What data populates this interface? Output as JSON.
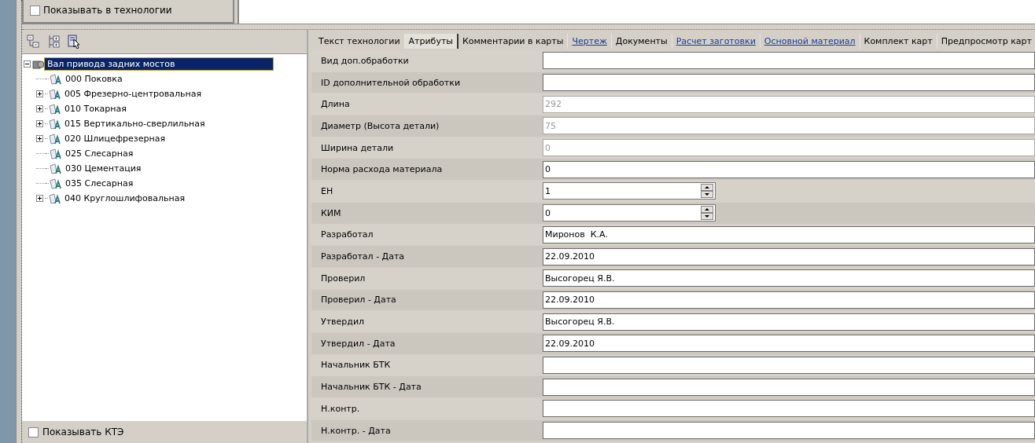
{
  "top_group": {
    "checkbox": {
      "label": "Показывать в технологии",
      "checked": false
    }
  },
  "tree_toolbar": {
    "buttons": [
      {
        "kind": "collapse"
      },
      {
        "kind": "expand"
      },
      {
        "kind": "select"
      }
    ]
  },
  "tree": {
    "root": {
      "label": "Вал привода задних мостов",
      "selected": true,
      "expanded": true,
      "children": [
        {
          "label": "000 Поковка",
          "selected": false
        },
        {
          "label": "005 Фрезерно-центровальная",
          "selected": false,
          "expanded": false
        },
        {
          "label": "010 Токарная",
          "selected": false,
          "expanded": false
        },
        {
          "label": "015 Вертикально-сверлильная",
          "selected": false,
          "expanded": false
        },
        {
          "label": "020 Шлицефрезерная",
          "selected": false,
          "expanded": false
        },
        {
          "label": "025 Слесарная",
          "selected": false
        },
        {
          "label": "030 Цементация",
          "selected": false
        },
        {
          "label": "035 Слесарная",
          "selected": false
        },
        {
          "label": "040 Круглошлифовальная",
          "selected": false,
          "expanded": false
        }
      ]
    }
  },
  "bottom_checkbox": {
    "label": "Показывать КТЭ",
    "checked": false
  },
  "tabs": [
    {
      "label": "Текст технологии",
      "selected": false,
      "kind": "plain"
    },
    {
      "label": "Атрибуты",
      "selected": true,
      "kind": "plain"
    },
    {
      "label": "Комментарии в карты",
      "selected": false,
      "kind": "plain"
    },
    {
      "label": "Чертеж",
      "selected": false,
      "kind": "link"
    },
    {
      "label": "Документы",
      "selected": false,
      "kind": "plain"
    },
    {
      "label": "Расчет заготовки",
      "selected": false,
      "kind": "link"
    },
    {
      "label": "Основной материал",
      "selected": false,
      "kind": "link"
    },
    {
      "label": "Комплект карт",
      "selected": false,
      "kind": "plain"
    },
    {
      "label": "Предпросмотр карт",
      "selected": false,
      "kind": "plain"
    }
  ],
  "attributes": [
    {
      "label": "Вид доп.обработки",
      "kind": "text",
      "disabled": false
    },
    {
      "label": "ID дополнительной обработки",
      "kind": "text",
      "disabled": false
    },
    {
      "label": "Длина",
      "kind": "text",
      "value": "292",
      "disabled": true
    },
    {
      "label": "Диаметр (Высота детали)",
      "kind": "text",
      "value": "75",
      "disabled": true
    },
    {
      "label": "Ширина детали",
      "kind": "text",
      "value": "0",
      "disabled": true
    },
    {
      "label": "Норма расхода материала",
      "kind": "text",
      "value": "0",
      "disabled": false
    },
    {
      "label": "ЕН",
      "kind": "spin",
      "value": "1",
      "disabled": false
    },
    {
      "label": "КИМ",
      "kind": "spin",
      "value": "0",
      "disabled": false
    },
    {
      "label": "Разработал",
      "kind": "text",
      "value": "Миронов  К.А.",
      "disabled": false
    },
    {
      "label": "Разработал - Дата",
      "kind": "text",
      "value": "22.09.2010",
      "disabled": false
    },
    {
      "label": "Проверил",
      "kind": "text",
      "value": "Высогорец Я.В.",
      "disabled": false
    },
    {
      "label": "Проверил - Дата",
      "kind": "text",
      "value": "22.09.2010",
      "disabled": false
    },
    {
      "label": "Утвердил",
      "kind": "text",
      "value": "Высогорец Я.В.",
      "disabled": false
    },
    {
      "label": "Утвердил - Дата",
      "kind": "text",
      "value": "22.09.2010",
      "disabled": false
    },
    {
      "label": "Начальник БТК",
      "kind": "text",
      "disabled": false
    },
    {
      "label": "Начальник БТК - Дата",
      "kind": "text",
      "disabled": false
    },
    {
      "label": "Н.контр.",
      "kind": "text",
      "disabled": false
    },
    {
      "label": "Н.контр. - Дата",
      "kind": "text",
      "disabled": false
    }
  ]
}
